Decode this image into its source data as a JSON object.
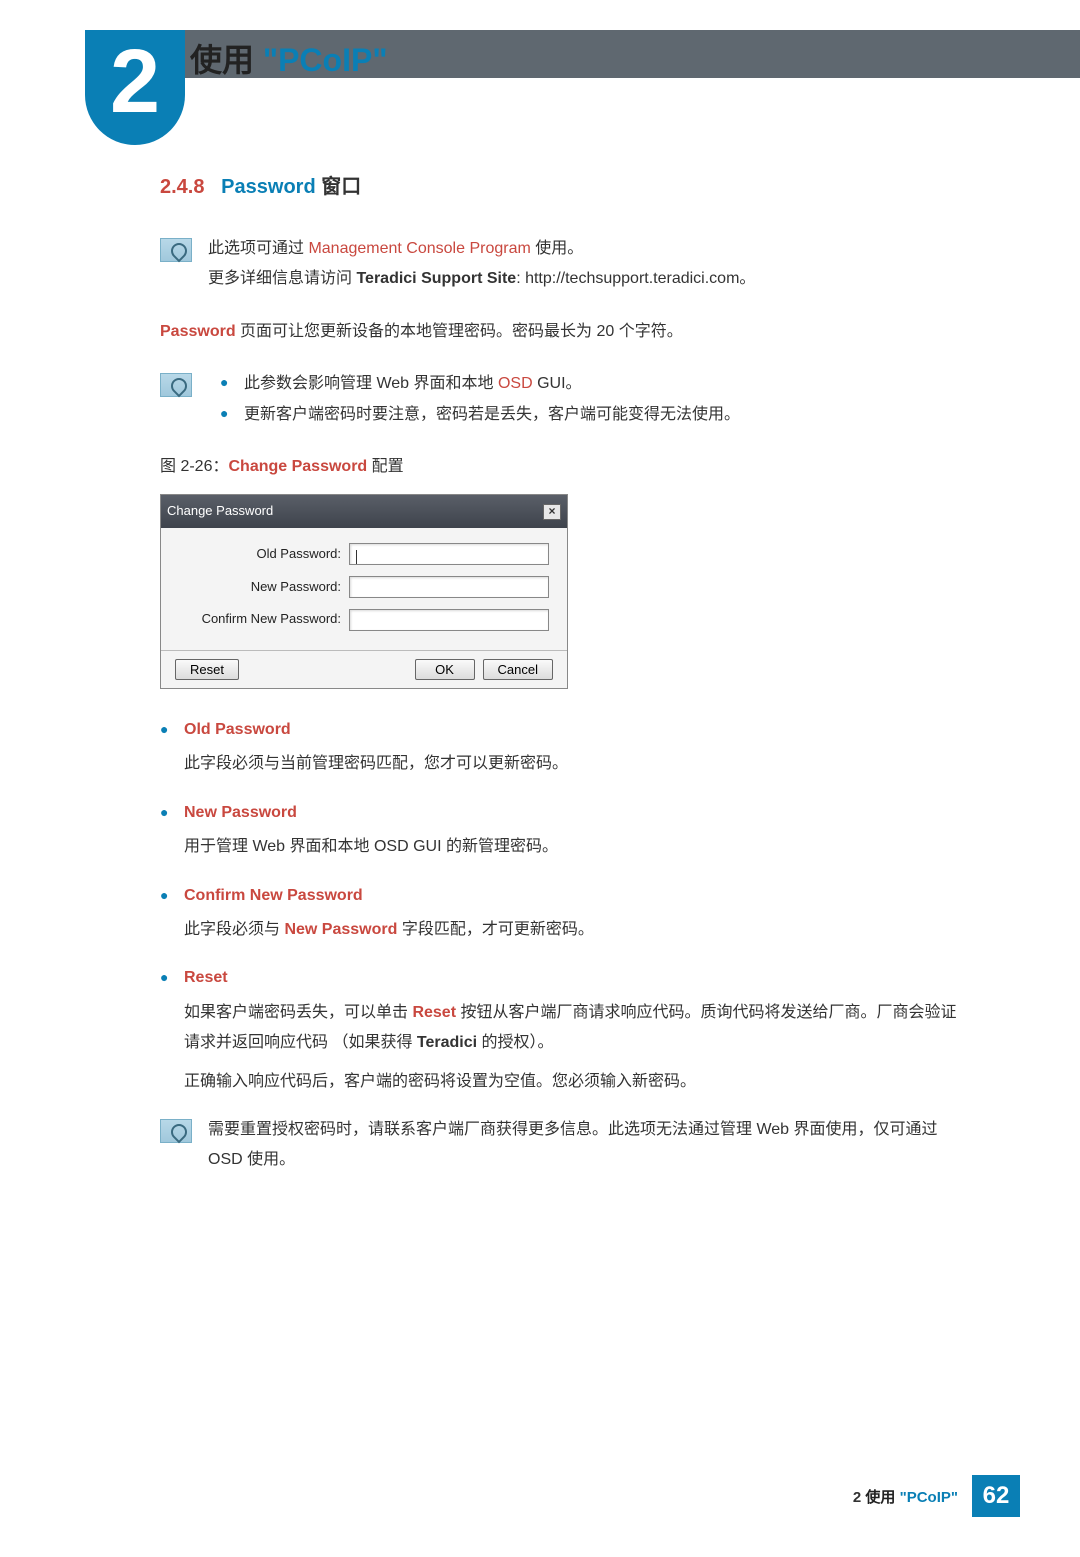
{
  "chapter": {
    "number": "2",
    "title_black": "使用 ",
    "title_blue": "\"PCoIP\""
  },
  "section": {
    "number": "2.4.8",
    "keyword": "Password",
    "rest": " 窗口"
  },
  "note1": {
    "line1_a": "此选项可通过 ",
    "line1_kw": "Management Console Program",
    "line1_b": " 使用。",
    "line2_a": "更多详细信息请访问 ",
    "line2_b": "Teradici Support Site",
    "line2_c": ": http://techsupport.teradici.com。"
  },
  "body1": {
    "kw": "Password",
    "rest": " 页面可让您更新设备的本地管理密码。密码最长为 20 个字符。"
  },
  "note2_bullets": [
    {
      "a": "此参数会影响管理 Web 界面和本地 ",
      "kw": "OSD",
      "b": " GUI。"
    },
    {
      "a": "更新客户端密码时要注意，密码若是丢失，客户端可能变得无法使用。",
      "kw": "",
      "b": ""
    }
  ],
  "figure": {
    "a": "图 2-26：",
    "kw": "Change Password",
    "b": " 配置"
  },
  "dialog": {
    "title": "Change Password",
    "fields": [
      {
        "label": "Old Password:"
      },
      {
        "label": "New Password:"
      },
      {
        "label": "Confirm New Password:"
      }
    ],
    "buttons": {
      "reset": "Reset",
      "ok": "OK",
      "cancel": "Cancel"
    }
  },
  "defs": [
    {
      "title": "Old Password",
      "body_a": "此字段必须与当前管理密码匹配，您才可以更新密码。",
      "body_kw": "",
      "body_b": ""
    },
    {
      "title": "New Password",
      "body_a": "用于管理 Web 界面和本地 OSD GUI 的新管理密码。",
      "body_kw": "",
      "body_b": ""
    },
    {
      "title": "Confirm New Password",
      "body_a": "此字段必须与 ",
      "body_kw": "New Password",
      "body_b": " 字段匹配，才可更新密码。"
    },
    {
      "title": "Reset",
      "body_a": "如果客户端密码丢失，可以单击 ",
      "body_kw": "Reset",
      "body_b": " 按钮从客户端厂商请求响应代码。质询代码将发送给厂商。厂商会验证请求并返回响应代码 （如果获得 ",
      "body_kw2": "Teradici",
      "body_c": " 的授权）。",
      "body_d": "正确输入响应代码后，客户端的密码将设置为空值。您必须输入新密码。"
    }
  ],
  "note3": "需要重置授权密码时，请联系客户端厂商获得更多信息。此选项无法通过管理 Web 界面使用，仅可通过 OSD 使用。",
  "footer": {
    "pre": "2 ",
    "black": "使用 ",
    "blue": "\"PCoIP\"",
    "page": "62"
  }
}
